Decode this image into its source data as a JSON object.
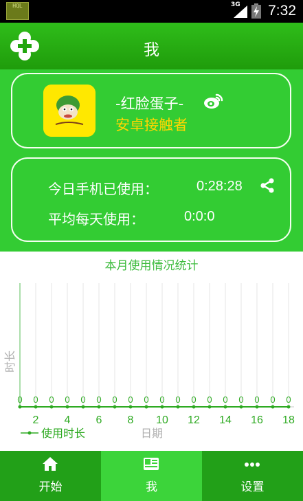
{
  "status_bar": {
    "app_icon_text": "HQL",
    "network": "3G",
    "time": "7:32"
  },
  "header": {
    "title": "我"
  },
  "profile": {
    "username": "-红脸蛋子-",
    "tag": "安卓接触者",
    "avatar_icon": "cartoon-avatar"
  },
  "usage": {
    "today_label": "今日手机已使用：",
    "today_value": "0:28:28",
    "average_label": "平均每天使用：",
    "average_value": "0:0:0"
  },
  "chart_data": {
    "type": "line",
    "title": "本月使用情况统计",
    "xlabel": "日期",
    "ylabel": "时长",
    "x": [
      1,
      2,
      3,
      4,
      5,
      6,
      7,
      8,
      9,
      10,
      11,
      12,
      13,
      14,
      15,
      16,
      17,
      18
    ],
    "x_tick_labels": [
      "2",
      "4",
      "6",
      "8",
      "10",
      "12",
      "14",
      "16",
      "18"
    ],
    "series": [
      {
        "name": "使用时长",
        "values": [
          0,
          0,
          0,
          0,
          0,
          0,
          0,
          0,
          0,
          0,
          0,
          0,
          0,
          0,
          0,
          0,
          0,
          0
        ]
      }
    ],
    "point_labels": [
      "0",
      "0",
      "0",
      "0",
      "0",
      "0",
      "0",
      "0",
      "0",
      "0",
      "0",
      "0",
      "0",
      "0",
      "0",
      "0",
      "0",
      "0"
    ],
    "grid": true,
    "legend_position": "bottom-left",
    "series_color": "#2eaa22"
  },
  "bottom_nav": {
    "items": [
      {
        "label": "开始",
        "icon": "home-icon"
      },
      {
        "label": "我",
        "icon": "profile-card-icon"
      },
      {
        "label": "设置",
        "icon": "more-dots-icon"
      }
    ]
  },
  "colors": {
    "primary": "#33cc33",
    "header": "#22a60e",
    "nav": "#22a018",
    "nav_active": "#3cd43a",
    "accent_text": "#ffd600"
  }
}
